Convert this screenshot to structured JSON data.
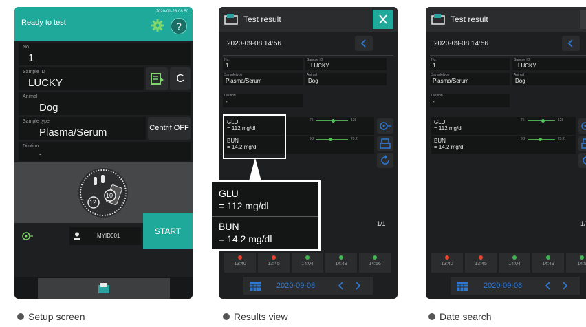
{
  "setup": {
    "status": "Ready to test",
    "datetime": "2020-01-28  08:50",
    "help_label": "?",
    "no_label": "No.",
    "no_value": "1",
    "sample_id_label": "Sample ID",
    "sample_id_value": "LUCKY",
    "c_button": "C",
    "animal_label": "Animal",
    "animal_value": "Dog",
    "sample_type_label": "Sample type",
    "sample_type_value": "Plasma/Serum",
    "centrif_button": "Centrif OFF",
    "dilution_label": "Dilution",
    "dilution_value": "-",
    "rotor_num1": "12",
    "rotor_num2": "10",
    "start_button": "START",
    "operator_value": "MYID001"
  },
  "results": {
    "title": "Test result",
    "datetime": "2020-09-08  14:56",
    "no_label": "No.",
    "no_value": "1",
    "sample_id_label": "Sample ID",
    "sample_id_value": "LUCKY",
    "sampletype_label": "Sampletype",
    "sampletype_value": "Plasma/Serum",
    "animal_label": "Animal",
    "animal_value": "Dog",
    "dilution_label": "Dilution",
    "dilution_value": "-",
    "glu_name": "GLU",
    "glu_value": "= 112 mg/dl",
    "glu_min": "75",
    "glu_max": "128",
    "bun_name": "BUN",
    "bun_value": "= 14.2 mg/dl",
    "bun_min": "9.2",
    "bun_max": "29.2",
    "page": "1/1",
    "date_filter": "2020-09-08",
    "times": [
      "13:40",
      "13:45",
      "14:04",
      "14:49",
      "14:56"
    ],
    "time_status_colors": [
      "#e8412c",
      "#e8412c",
      "#3fb34f",
      "#3fb34f",
      "#3fb34f"
    ]
  },
  "zoom": {
    "glu_name": "GLU",
    "glu_value": "= 112 mg/dl",
    "bun_name": "BUN",
    "bun_value": "= 14.2 mg/dl"
  },
  "datesearch": {
    "title": "Test result",
    "datetime": "2020-09-08  14:56",
    "no_label": "No.",
    "no_value": "1",
    "sample_id_label": "Sample ID",
    "sample_id_value": "LUCKY",
    "sampletype_label": "Sampletype",
    "sampletype_value": "Plasma/Serum",
    "animal_label": "Animal",
    "animal_value": "Dog",
    "dilution_label": "Dilution",
    "dilution_value": "-",
    "glu_name": "GLU",
    "glu_value": "= 112 mg/dl",
    "glu_min": "75",
    "glu_max": "128",
    "bun_name": "BUN",
    "bun_value": "= 14.2 mg/dl",
    "bun_min": "9.2",
    "bun_max": "29.2",
    "page": "1/",
    "date_filter": "2020-09-08",
    "times": [
      "13:40",
      "13:45",
      "14:04",
      "14:49",
      "14:5"
    ]
  },
  "captions": {
    "setup": "Setup screen",
    "results": "Results view",
    "datesearch": "Date search"
  },
  "colors": {
    "teal": "#1fa99a",
    "accent_blue": "#2e78d2",
    "screen_bg": "#1e1f20",
    "field_bg": "#141515"
  }
}
